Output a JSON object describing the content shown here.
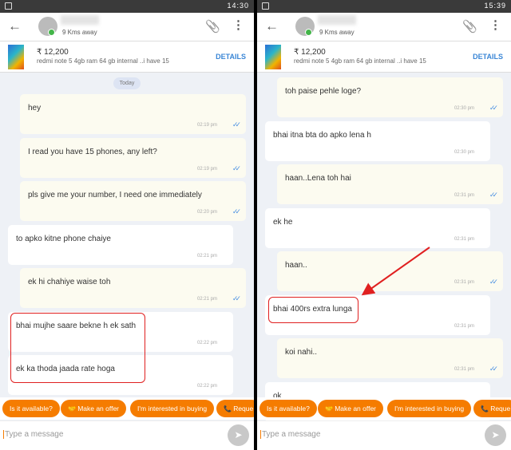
{
  "panes": [
    {
      "status_time": "14:30",
      "distance": "9 Kms away",
      "price": "₹ 12,200",
      "product_title": "redmi note 5 4gb ram 64 gb internal ..i have 15",
      "details": "DETAILS",
      "date_label": "Today",
      "messages": [
        {
          "type": "sent",
          "text": "hey",
          "time": "02:19 pm"
        },
        {
          "type": "sent",
          "text": "I read you have 15 phones, any left?",
          "time": "02:19 pm"
        },
        {
          "type": "sent",
          "text": "pls give me your number, I need one immediately",
          "time": "02:20 pm"
        },
        {
          "type": "recv",
          "text": "to apko kitne phone chaiye",
          "time": "02:21 pm"
        },
        {
          "type": "sent",
          "text": "ek hi chahiye waise toh",
          "time": "02:21 pm"
        },
        {
          "type": "recv",
          "text": "bhai mujhe saare bekne h ek sath",
          "time": "02:22 pm"
        },
        {
          "type": "recv",
          "text": "ek ka thoda jaada rate hoga",
          "time": "02:22 pm"
        }
      ]
    },
    {
      "status_time": "15:39",
      "distance": "9 Kms away",
      "price": "₹ 12,200",
      "product_title": "redmi note 5 4gb ram 64 gb internal ..i have 15",
      "details": "DETAILS",
      "messages": [
        {
          "type": "sent",
          "text": "toh paise pehle loge?",
          "time": "02:30 pm"
        },
        {
          "type": "recv",
          "text": "bhai itna bta do apko lena h",
          "time": "02:30 pm"
        },
        {
          "type": "sent",
          "text": "haan..Lena toh hai",
          "time": "02:31 pm"
        },
        {
          "type": "recv",
          "text": "ek he",
          "time": "02:31 pm"
        },
        {
          "type": "sent",
          "text": "haan..",
          "time": "02:31 pm"
        },
        {
          "type": "recv",
          "text": "bhai 400rs extra lunga",
          "time": "02:31 pm"
        },
        {
          "type": "sent",
          "text": "koi nahi..",
          "time": "02:31 pm"
        },
        {
          "type": "recv",
          "text": "ok",
          "time": ""
        }
      ]
    }
  ],
  "quick_replies": [
    {
      "label": "Is it available?",
      "icon": ""
    },
    {
      "label": "Make an offer",
      "icon": "handshake-icon"
    },
    {
      "label": "I'm interested in buying",
      "icon": ""
    },
    {
      "label": "Reque",
      "icon": "phone-icon"
    }
  ],
  "input_placeholder": "Type a message",
  "colors": {
    "accent": "#f57c00",
    "link": "#3a86d6",
    "annotation": "#e02020",
    "sent_bubble": "#fcfbf0",
    "read_ticks": "#4a90e2"
  }
}
